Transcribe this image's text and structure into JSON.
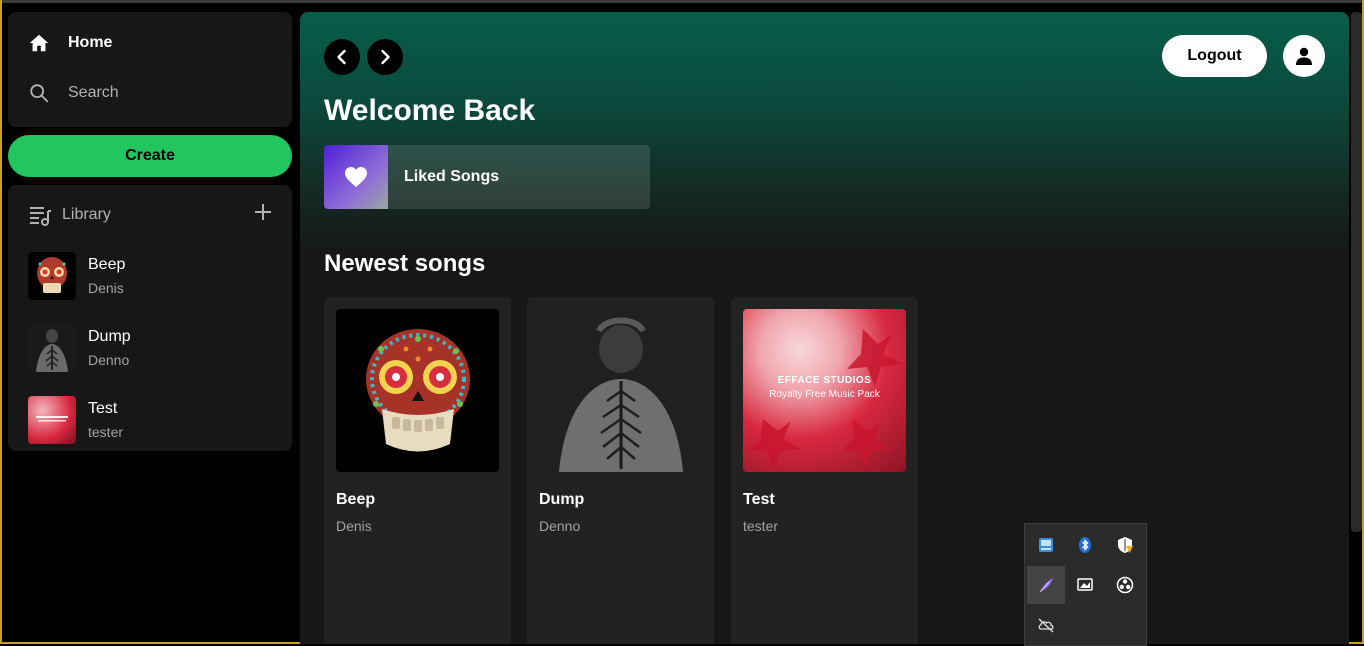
{
  "sidebar": {
    "nav": {
      "home_label": "Home",
      "search_label": "Search"
    },
    "create_label": "Create",
    "library": {
      "title": "Library",
      "items": [
        {
          "title": "Beep",
          "author": "Denis"
        },
        {
          "title": "Dump",
          "author": "Denno"
        },
        {
          "title": "Test",
          "author": "tester"
        }
      ]
    }
  },
  "header": {
    "logout_label": "Logout"
  },
  "main": {
    "welcome": "Welcome Back",
    "liked_label": "Liked Songs",
    "newest_title": "Newest songs",
    "cards": [
      {
        "title": "Beep",
        "author": "Denis"
      },
      {
        "title": "Dump",
        "author": "Denno"
      },
      {
        "title": "Test",
        "author": "tester"
      }
    ],
    "test_art_text": {
      "line1": "EFFACE STUDIOS",
      "line2": "Royalty Free Music Pack"
    }
  },
  "colors": {
    "accent": "#22c55e",
    "sidebar_bg": "#171717",
    "header_green": "#075e4a"
  },
  "tray_icons": [
    "network-icon",
    "bluetooth-icon",
    "security-warning-icon",
    "feather-icon",
    "display-icon",
    "obs-icon",
    "cloud-off-icon"
  ]
}
